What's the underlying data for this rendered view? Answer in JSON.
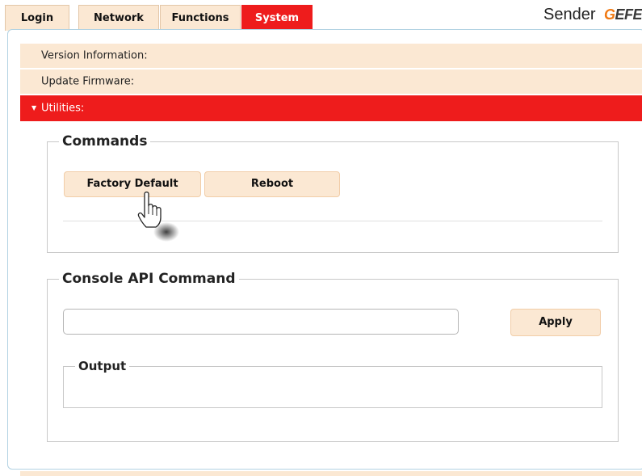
{
  "tabs": [
    {
      "label": "Login"
    },
    {
      "label": "Network"
    },
    {
      "label": "Functions"
    },
    {
      "label": "System",
      "active": true
    }
  ],
  "header": {
    "device_label": "Sender",
    "logo_text": "GEFE"
  },
  "accordion": [
    {
      "label": "Version Information:",
      "expanded": false
    },
    {
      "label": "Update Firmware:",
      "expanded": false
    },
    {
      "label": "Utilities:",
      "expanded": true
    }
  ],
  "commands": {
    "legend": "Commands",
    "factory_default_label": "Factory Default",
    "reboot_label": "Reboot"
  },
  "console": {
    "legend": "Console API Command",
    "input_value": "",
    "apply_label": "Apply",
    "output_legend": "Output",
    "output_text": ""
  },
  "colors": {
    "accent_red": "#ee1c1c",
    "tab_peach": "#fbe8d3",
    "panel_border": "#b3d3e3",
    "logo_orange": "#f07a14"
  },
  "icons": {
    "expand_arrow": "triangle-down-icon",
    "cursor": "hand-pointer-icon"
  }
}
